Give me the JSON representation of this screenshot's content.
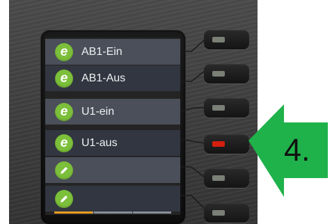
{
  "screen": {
    "items": [
      {
        "label": "AB1-Ein",
        "icon": "e-logo-icon"
      },
      {
        "label": "AB1-Aus",
        "icon": "e-logo-icon"
      },
      {
        "label": "U1-ein",
        "icon": "e-logo-icon"
      },
      {
        "label": "U1-aus",
        "icon": "e-logo-icon"
      },
      {
        "label": "",
        "icon": "pencil-icon"
      },
      {
        "label": "",
        "icon": "pencil-icon"
      }
    ],
    "page_progress": 0.33
  },
  "keys": [
    {
      "led_state": "off"
    },
    {
      "led_state": "off"
    },
    {
      "led_state": "off"
    },
    {
      "led_state": "red"
    },
    {
      "led_state": "off"
    },
    {
      "led_state": "off"
    }
  ],
  "annotation": {
    "label": "4.",
    "color": "#1fb24a"
  },
  "colors": {
    "icon_green": "#7cbf3a",
    "led_red": "#d41e10",
    "progress": "#f0a020"
  }
}
